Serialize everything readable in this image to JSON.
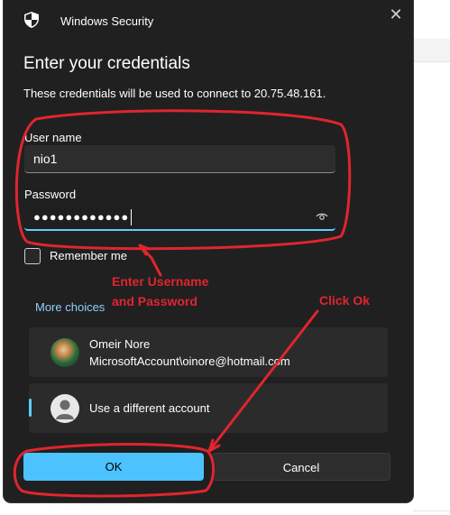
{
  "window": {
    "title": "Windows Security",
    "close_glyph": "✕"
  },
  "dialog": {
    "heading": "Enter your credentials",
    "description": "These credentials will be used to connect to 20.75.48.161."
  },
  "form": {
    "username_label": "User name",
    "username_value": "nio1",
    "password_label": "Password",
    "password_mask": "●●●●●●●●●●●●",
    "remember_label": "Remember me",
    "remember_checked": false
  },
  "more_choices": "More choices",
  "accounts": [
    {
      "name": "Omeir Nore",
      "detail": "MicrosoftAccount\\oinore@hotmail.com"
    },
    {
      "label": "Use a different account",
      "selected": true
    }
  ],
  "buttons": {
    "ok": "OK",
    "cancel": "Cancel"
  },
  "annotations": {
    "enter_line1": "Enter Username",
    "enter_line2": "and Password",
    "click_ok": "Click Ok",
    "color": "#e0252e"
  },
  "colors": {
    "accent": "#4cc2ff",
    "link": "#8ed1f8",
    "dialog_bg": "#202020"
  },
  "icons": [
    "shield-icon",
    "close-icon",
    "eye-icon",
    "user-avatar-icon"
  ]
}
